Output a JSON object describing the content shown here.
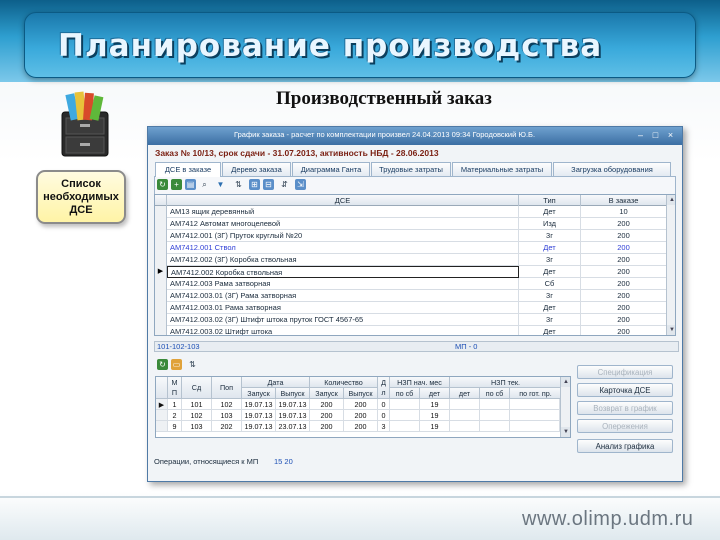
{
  "slide": {
    "title": "Планирование производства",
    "subtitle": "Производственный заказ",
    "callout": "Список необходимых ДСЕ",
    "footer_url": "www.olimp.udm.ru"
  },
  "window": {
    "title": "График заказа - расчет по комплектации произвел 24.04.2013 09:34  Городовский Ю.Б.",
    "controls": [
      "–",
      "□",
      "×"
    ],
    "order_info": "Заказ № 10/13,   срок сдачи - 31.07.2013,   активность НБД - 28.06.2013",
    "tabs": [
      "ДСЕ в заказе",
      "Дерево заказа",
      "Диаграмма Ганта",
      "Трудовые затраты",
      "Материальные затраты",
      "Загрузка оборудования"
    ],
    "active_tab": 0
  },
  "dse_grid": {
    "columns": [
      "ДСЕ",
      "Тип",
      "В заказе"
    ],
    "rows": [
      {
        "name": "АМ13 ящик деревянный",
        "type": "Дет",
        "qty": "10"
      },
      {
        "name": "АМ7412 Автомат многоцелевой",
        "type": "Изд",
        "qty": "200"
      },
      {
        "name": "АМ7412.001 (3Г) Пруток круглый №20",
        "type": "3г",
        "qty": "200"
      },
      {
        "name": "АМ7412.001 Ствол",
        "type": "Дет",
        "qty": "200",
        "highlight": true
      },
      {
        "name": "АМ7412.002 (3Г) Коробка ствольная",
        "type": "3г",
        "qty": "200"
      },
      {
        "name": "АМ7412.002 Коробка ствольная",
        "type": "Дет",
        "qty": "200",
        "current": true
      },
      {
        "name": "АМ7412.003 Рама затворная",
        "type": "Сб",
        "qty": "200"
      },
      {
        "name": "АМ7412.003.01 (3Г) Рама затворная",
        "type": "3г",
        "qty": "200"
      },
      {
        "name": "АМ7412.003.01 Рама затворная",
        "type": "Дет",
        "qty": "200"
      },
      {
        "name": "АМ7412.003.02 (3Г) Штифт штока пруток ГОСТ 4567-65",
        "type": "3г",
        "qty": "200"
      },
      {
        "name": "АМ7412.003.02 Штифт штока",
        "type": "Дет",
        "qty": "200"
      }
    ]
  },
  "status_bar": {
    "code": "101-102-103",
    "mp": "МП - 0"
  },
  "ops_grid": {
    "headers": {
      "mp": "М П",
      "sd": "Сд",
      "pod": "Поп",
      "date_group": "Дата",
      "qty_group": "Количество",
      "dl": "Д л",
      "nzp_start_group": "НЗП нач. мес",
      "nzp_tek_group": "НЗП тек.",
      "start": "Запуск",
      "release": "Выпуск",
      "qstart": "Запуск",
      "qrelease": "Выпуск",
      "nzp_sb1": "по сб",
      "nzp_det1": "дет",
      "nzp_det2": "дет",
      "nzp_sb2": "по сб",
      "nzp_gp": "по гот. пр."
    },
    "rows": [
      {
        "mp": "1",
        "sd": "101",
        "pod": "102",
        "start": "19.07.13",
        "release": "19.07.13",
        "qstart": "200",
        "qrelease": "200",
        "dl": "0",
        "nzp_det1": "19"
      },
      {
        "mp": "2",
        "sd": "102",
        "pod": "103",
        "start": "19.07.13",
        "release": "19.07.13",
        "qstart": "200",
        "qrelease": "200",
        "dl": "0",
        "nzp_det1": "19"
      },
      {
        "mp": "9",
        "sd": "103",
        "pod": "202",
        "start": "19.07.13",
        "release": "23.07.13",
        "qstart": "200",
        "qrelease": "200",
        "dl": "3",
        "nzp_det1": "19"
      }
    ]
  },
  "side_buttons": [
    {
      "label": "Спецификация",
      "enabled": false
    },
    {
      "label": "Карточка ДСЕ",
      "enabled": true
    },
    {
      "label": "Возврат в график",
      "enabled": false
    },
    {
      "label": "Опережения",
      "enabled": false
    },
    {
      "label": "Анализ графика",
      "enabled": true
    }
  ],
  "ops_footer": {
    "label": "Операции, относящиеся к МП",
    "value": "15 20"
  },
  "colors": {
    "title_band": "#2e9fd0",
    "order_info": "#7a1f12",
    "highlight_row": "#2f3fd6",
    "ops_value": "#1c4fb5"
  }
}
